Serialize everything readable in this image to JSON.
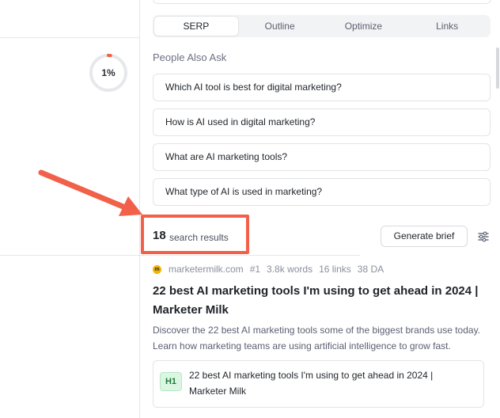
{
  "left": {
    "progress_label": "1%",
    "progress_percent": 1,
    "ring_track_color": "#e7e8eb",
    "ring_fill_color": "#f2604a"
  },
  "tabs": [
    {
      "label": "SERP",
      "active": true
    },
    {
      "label": "Outline",
      "active": false
    },
    {
      "label": "Optimize",
      "active": false
    },
    {
      "label": "Links",
      "active": false
    }
  ],
  "paa": {
    "heading": "People Also Ask",
    "questions": [
      "Which AI tool is best for digital marketing?",
      "How is AI used in digital marketing?",
      "What are AI marketing tools?",
      "What type of AI is used in marketing?"
    ]
  },
  "results": {
    "count": "18",
    "label": "search results",
    "generate_brief_label": "Generate brief",
    "filter_icon": "sliders-icon",
    "items": [
      {
        "favicon_letter": "m",
        "domain": "marketermilk.com",
        "rank": "#1",
        "words": "3.8k words",
        "links": "16 links",
        "da": "38 DA",
        "title": "22 best AI marketing tools I'm using to get ahead in 2024 | Marketer Milk",
        "description": "Discover the 22 best AI marketing tools some of the biggest brands use today. Learn how marketing teams are using artificial intelligence to grow fast.",
        "heading_tag": "H1",
        "heading_text": "22 best AI marketing tools I'm using to get ahead in 2024 | Marketer Milk"
      }
    ]
  },
  "annotation": {
    "color": "#f2604a"
  }
}
